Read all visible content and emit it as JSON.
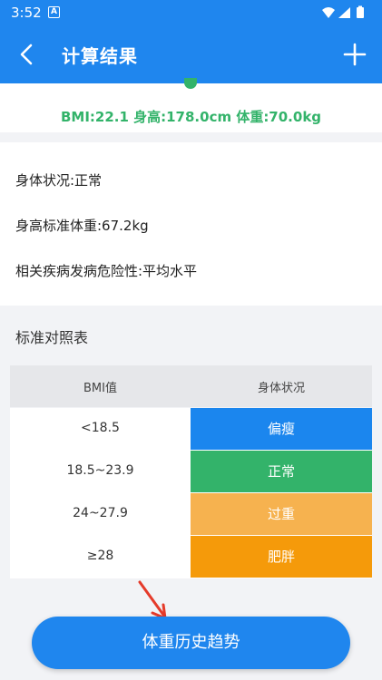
{
  "status_bar": {
    "time": "3:52",
    "notification_icon": "A"
  },
  "app_bar": {
    "title": "计算结果"
  },
  "summary": {
    "text": "BMI:22.1  身高:178.0cm  体重:70.0kg"
  },
  "info": {
    "items": [
      "身体状况:正常",
      "身高标准体重:67.2kg",
      "相关疾病发病危险性:平均水平"
    ]
  },
  "reference": {
    "title": "标准对照表",
    "headers": [
      "BMI值",
      "身体状况"
    ],
    "rows": [
      {
        "range": "<18.5",
        "status": "偏瘦",
        "color": "#1b86ee"
      },
      {
        "range": "18.5~23.9",
        "status": "正常",
        "color": "#33b36a"
      },
      {
        "range": "24~27.9",
        "status": "过重",
        "color": "#f6b24f"
      },
      {
        "range": "≥28",
        "status": "肥胖",
        "color": "#f59a0a"
      }
    ]
  },
  "cta": {
    "label": "体重历史趋势"
  },
  "colors": {
    "primary": "#1f86ee",
    "accent_green": "#33b36a"
  }
}
